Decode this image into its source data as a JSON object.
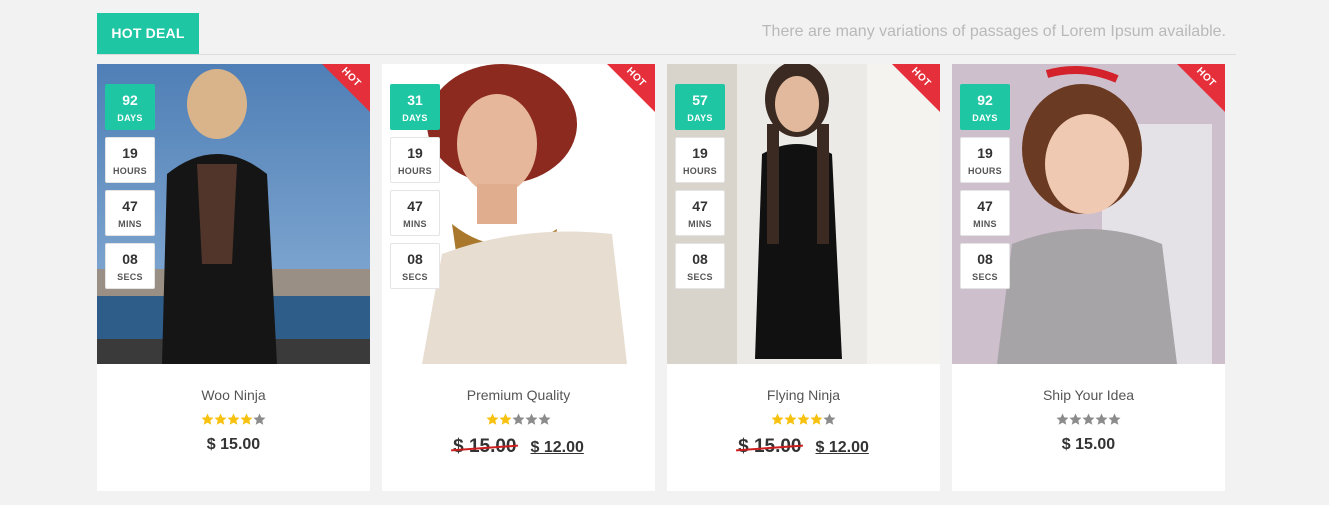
{
  "header": {
    "tab_label": "HOT DEAL",
    "tagline": "There are many variations of passages of Lorem Ipsum available."
  },
  "colors": {
    "accent": "#1fc6a4",
    "hot": "#e52f3b",
    "star": "#f7c20f",
    "star_empty": "#8c8c8c"
  },
  "products": [
    {
      "name": "Woo Ninja",
      "badge": "HOT",
      "countdown": {
        "days": "92",
        "hours": "19",
        "mins": "47",
        "secs": "08",
        "days_label": "DAYS",
        "hours_label": "HOURS",
        "mins_label": "MINS",
        "secs_label": "SECS"
      },
      "rating": 4,
      "price": "$ 15.00",
      "old_price": null,
      "new_price": null
    },
    {
      "name": "Premium Quality",
      "badge": "HOT",
      "countdown": {
        "days": "31",
        "hours": "19",
        "mins": "47",
        "secs": "08",
        "days_label": "DAYS",
        "hours_label": "HOURS",
        "mins_label": "MINS",
        "secs_label": "SECS"
      },
      "rating": 2,
      "price": null,
      "old_price": "$ 15.00",
      "new_price": "$ 12.00"
    },
    {
      "name": "Flying Ninja",
      "badge": "HOT",
      "countdown": {
        "days": "57",
        "hours": "19",
        "mins": "47",
        "secs": "08",
        "days_label": "DAYS",
        "hours_label": "HOURS",
        "mins_label": "MINS",
        "secs_label": "SECS"
      },
      "rating": 4,
      "price": null,
      "old_price": "$ 15.00",
      "new_price": "$ 12.00"
    },
    {
      "name": "Ship Your Idea",
      "badge": "HOT",
      "countdown": {
        "days": "92",
        "hours": "19",
        "mins": "47",
        "secs": "08",
        "days_label": "DAYS",
        "hours_label": "HOURS",
        "mins_label": "MINS",
        "secs_label": "SECS"
      },
      "rating": 0,
      "price": "$ 15.00",
      "old_price": null,
      "new_price": null
    }
  ]
}
